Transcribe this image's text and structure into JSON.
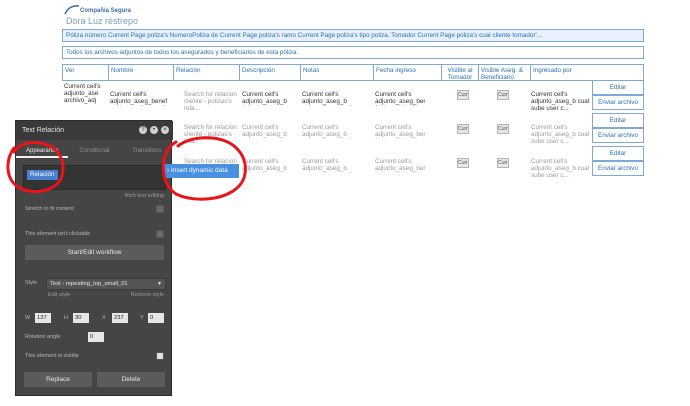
{
  "logo": {
    "company": "Compañía Segura",
    "name": "Dora Luz restrepo"
  },
  "bars": {
    "policy": "Póliza número Current Page poliza's NumeroPoliza  de Current Page poliza's ramo Current Page poliza's tipo poliza.  Tomador Current Page poliza's cual cliente tomador'...",
    "attachments": "Todos los archivos adjuntos de  todos los asegurados y beneficiarios de esta póliza."
  },
  "table": {
    "headers": [
      "Ver",
      "Nombre",
      "Relación",
      "Descripción",
      "Notas",
      "Fecha ingreso",
      "Visible al Tomador",
      "Visible Aseg. & Beneficiario",
      "Ingresado por"
    ],
    "row1": {
      "ver": "Current cell's adjunto_ase archivo_adj",
      "nombre": "Current cell's adjunto_aseg_benef cual user cliente adj...",
      "relacion": "Search for relacion cliente - polizas's rela...",
      "descripcion": "Current cell's adjunto_aseg_b descripcion",
      "notas": "Current cell's adjunto_aseg_b nota_adjunto_poliza",
      "fecha": "Current cell's adjunto_aseg_ber fecha subida:for...",
      "visible_tomador": "Curr",
      "visible_aseg": "Curr",
      "ingresado": "Current cell's adjunto_aseg_b cual sube user c..."
    },
    "row2": {
      "relacion": "Search for relacion cliente - polizas's rela...",
      "descripcion": "Current cell's adjunto_aseg_b descripcion",
      "notas": "Current cell's adjunto_aseg_b nota_adjunto_poliza",
      "fecha": "Current cell's adjunto_aseg_ber fecha subida:for...",
      "visible_tomador": "Curr",
      "visible_aseg": "Curr",
      "ingresado": "Current cell's adjunto_aseg_b cual sube user c..."
    },
    "row3": {
      "relacion": "Search for relacion cliente - polizas's rela...",
      "descripcion": "Current cell's adjunto_aseg_b descripcion",
      "notas": "Current cell's adjunto_aseg_b nota_adjunto_poliza",
      "fecha": "Current cell's adjunto_aseg_ber fecha subida:for...",
      "visible_tomador": "Curr",
      "visible_aseg": "Curr",
      "ingresado": "Current cell's adjunto_aseg_b cual sube user c..."
    },
    "editar": "Editar",
    "enviar": "Enviar archivo"
  },
  "panel": {
    "title": "Text Relación",
    "tabs": [
      "Appearance",
      "Conditional",
      "Transitions"
    ],
    "chip": "Relación",
    "rich_text": "Rich text editing",
    "stretch": "Stretch to fit content",
    "not_clickable": "This element isn't clickable",
    "workflow_button": "Start/Edit workflow",
    "style_label": "Style",
    "style_value": "Text - repeating_top_small_01",
    "edit_style": "Edit style",
    "remove_style": "Remove style",
    "w_label": "W",
    "w": "137",
    "h_label": "H",
    "h": "30",
    "x_label": "X",
    "x": "237",
    "y_label": "Y",
    "y": "0",
    "rotation_label": "Rotation angle",
    "rotation": "0",
    "visible": "This element is visible",
    "replace": "Replace",
    "delete": "Delete"
  },
  "dynamic": {
    "label": "Insert dynamic data",
    "caret": "›"
  },
  "colors": {
    "accent": "#2f6fb3",
    "chip": "#4a7fd0",
    "annotation": "#e8141a"
  }
}
